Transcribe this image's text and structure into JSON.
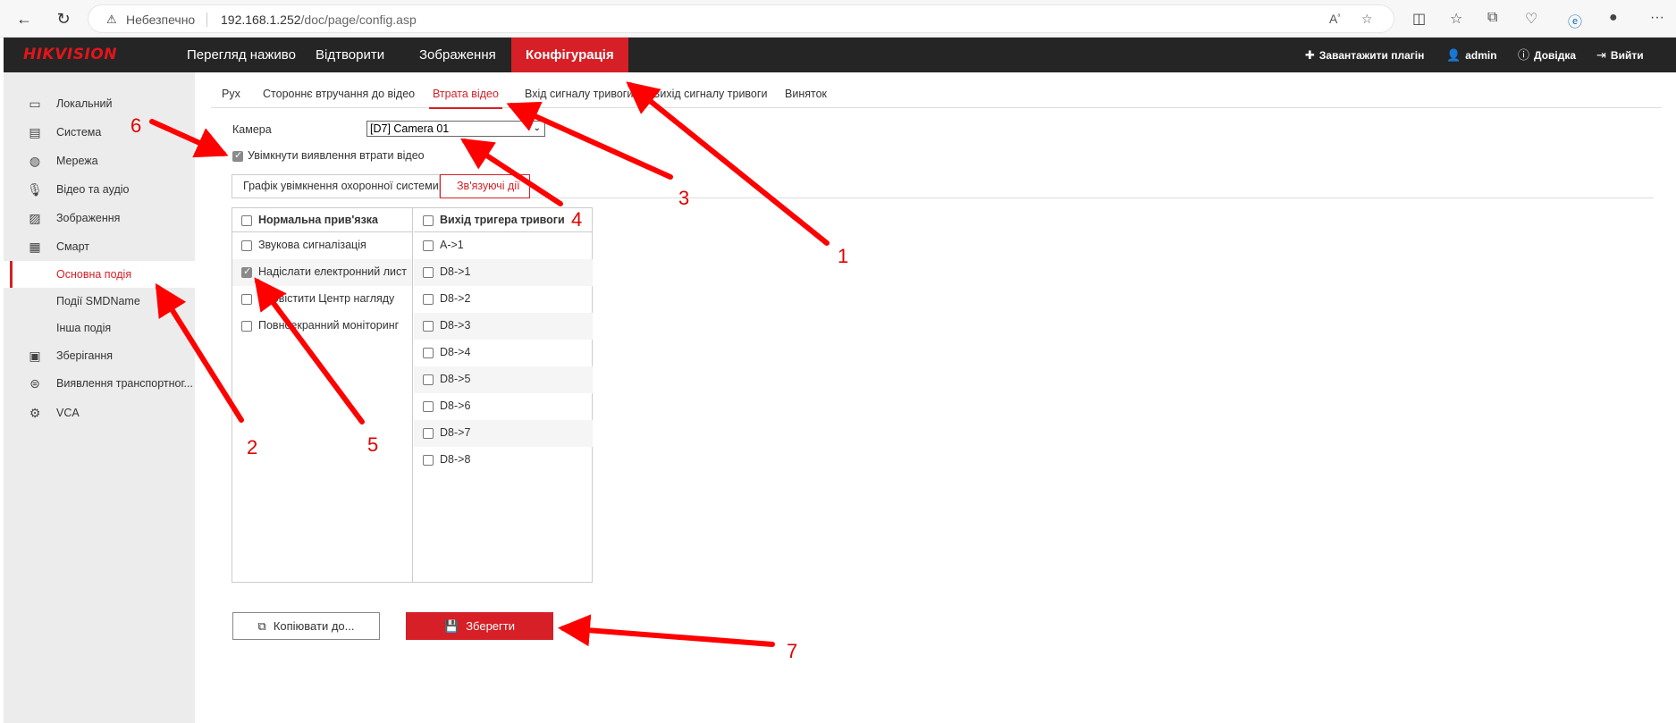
{
  "browser": {
    "insecure_label": "Небезпечно",
    "url_host": "192.168.1.252",
    "url_path": "/doc/page/config.asp"
  },
  "header": {
    "logo": "HIKVISION",
    "menu": [
      "Перегляд наживо",
      "Відтворити",
      "Зображення",
      "Конфігурація"
    ],
    "plugin_label": "Завантажити плагін",
    "user_label": "admin",
    "help_label": "Довідка",
    "logout_label": "Вийти"
  },
  "sidebar": {
    "items": [
      {
        "label": "Локальний",
        "icon": "monitor-icon"
      },
      {
        "label": "Система",
        "icon": "system-icon"
      },
      {
        "label": "Мережа",
        "icon": "globe-icon"
      },
      {
        "label": "Відео та аудіо",
        "icon": "mic-icon"
      },
      {
        "label": "Зображення",
        "icon": "image-icon"
      },
      {
        "label": "Смарт",
        "icon": "calendar-icon"
      },
      {
        "label": "Основна подія",
        "icon": ""
      },
      {
        "label": "Події SMDName",
        "icon": ""
      },
      {
        "label": "Інша подія",
        "icon": ""
      },
      {
        "label": "Зберігання",
        "icon": "storage-icon"
      },
      {
        "label": "Виявлення транспортног...",
        "icon": "vehicle-icon"
      },
      {
        "label": "VCA",
        "icon": "vca-icon"
      }
    ]
  },
  "tabs": [
    "Рух",
    "Стороннє втручання до відео",
    "Втрата відео",
    "Вхід сигналу тривоги",
    "Вихід сигналу тривоги",
    "Виняток"
  ],
  "camera": {
    "label": "Камера",
    "value": "[D7] Camera 01"
  },
  "enable_label": "Увімкнути виявлення втрати відео",
  "subtabs": [
    "Графік увімкнення охоронної системи",
    "Зв'язуючі дії"
  ],
  "linkage": {
    "normal_header": "Нормальна прив'язка",
    "normal_items": [
      {
        "label": "Звукова сигналізація",
        "checked": false
      },
      {
        "label": "Надіслати електронний лист",
        "checked": true
      },
      {
        "label": "Сповістити Центр нагляду",
        "checked": false
      },
      {
        "label": "Повноекранний моніторинг",
        "checked": false
      }
    ],
    "trigger_header": "Вихід тригера тривоги",
    "trigger_items": [
      "A->1",
      "D8->1",
      "D8->2",
      "D8->3",
      "D8->4",
      "D8->5",
      "D8->6",
      "D8->7",
      "D8->8"
    ]
  },
  "buttons": {
    "copy_label": "Копіювати до...",
    "save_label": "Зберегти"
  },
  "annotations": [
    "1",
    "2",
    "3",
    "4",
    "5",
    "6",
    "7"
  ],
  "colors": {
    "accent": "#d61f26",
    "arrow": "#ff0000"
  }
}
